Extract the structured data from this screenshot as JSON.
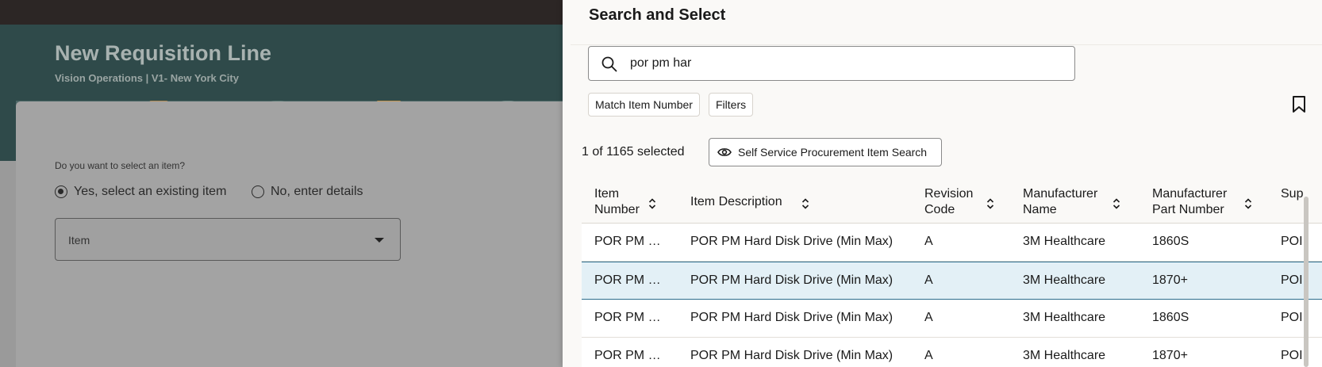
{
  "page": {
    "title": "New Requisition Line",
    "subtitle": "Vision Operations | V1- New York City",
    "question": "Do you want to select an item?",
    "radio_yes": "Yes, select an existing item",
    "radio_no": "No, enter details",
    "item_label": "Item"
  },
  "drawer": {
    "title": "Search and Select",
    "search_value": "por pm har",
    "chip_match": "Match Item Number",
    "chip_filters": "Filters",
    "selected_count": "1 of 1165 selected",
    "view_button": "Self Service Procurement Item Search"
  },
  "table": {
    "columns": [
      "Item Number",
      "Item Description",
      "Revision Code",
      "Manufacturer Name",
      "Manufacturer Part Number",
      "Sup"
    ],
    "col_lines": [
      [
        "Item",
        "Number"
      ],
      [
        "Item Description"
      ],
      [
        "Revision",
        "Code"
      ],
      [
        "Manufacturer",
        "Name"
      ],
      [
        "Manufacturer",
        "Part Number"
      ],
      [
        "Sup"
      ]
    ],
    "rows": [
      {
        "item_number": "POR PM …",
        "description": "POR PM Hard Disk Drive (Min Max)",
        "revision": "A",
        "manufacturer": "3M Healthcare",
        "part_number": "1860S",
        "supplier": "POI",
        "selected": false
      },
      {
        "item_number": "POR PM …",
        "description": "POR PM Hard Disk Drive (Min Max)",
        "revision": "A",
        "manufacturer": "3M Healthcare",
        "part_number": "1870+",
        "supplier": "POI",
        "selected": true
      },
      {
        "item_number": "POR PM …",
        "description": "POR PM Hard Disk Drive (Min Max)",
        "revision": "A",
        "manufacturer": "3M Healthcare",
        "part_number": "1860S",
        "supplier": "POI",
        "selected": false
      },
      {
        "item_number": "POR PM …",
        "description": "POR PM Hard Disk Drive (Min Max)",
        "revision": "A",
        "manufacturer": "3M Healthcare",
        "part_number": "1870+",
        "supplier": "POI",
        "selected": false
      }
    ]
  },
  "icons": {
    "search": "search-icon",
    "bookmark": "bookmark-icon",
    "view": "eye-icon",
    "sort": "sort-icon",
    "dropdown": "chevron-down-icon"
  },
  "colors": {
    "header_bg": "#2f4a4a",
    "drawer_bg": "#faf9f7",
    "selected_row_bg": "#e3f0f6",
    "selected_row_border": "#2c6d8c"
  }
}
